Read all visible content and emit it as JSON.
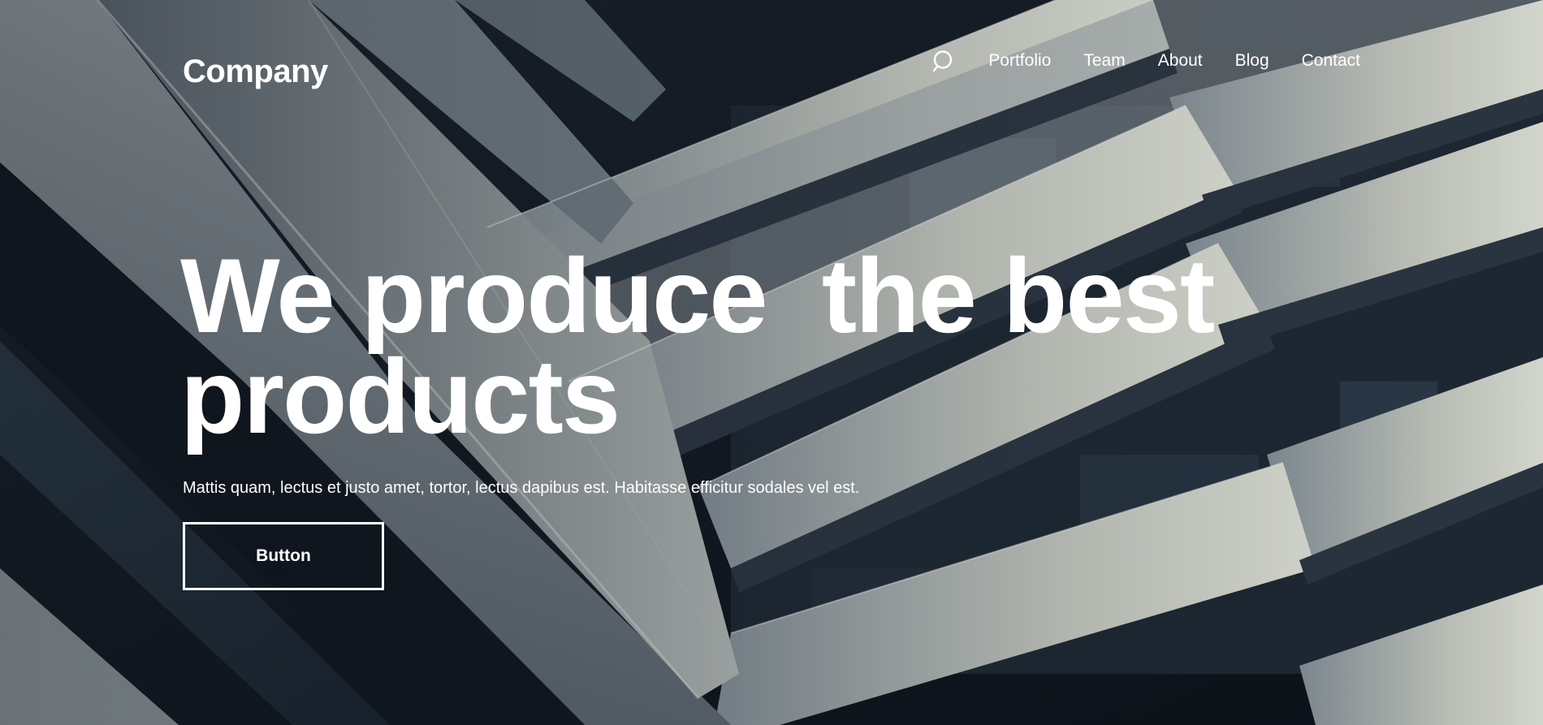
{
  "header": {
    "logo": "Company",
    "search_icon": "search-icon",
    "nav": [
      {
        "label": "Portfolio"
      },
      {
        "label": "Team"
      },
      {
        "label": "About"
      },
      {
        "label": "Blog"
      },
      {
        "label": "Contact"
      }
    ]
  },
  "hero": {
    "headline_line1": "We produce  the best",
    "headline_line2": "products",
    "subtitle": "Mattis quam, lectus et justo amet, tortor, lectus dapibus est. Habitasse efficitur sodales vel est.",
    "button_label": "Button"
  },
  "colors": {
    "text": "#ffffff",
    "background_dark": "#121821",
    "panel_light": "#c9ccc4"
  }
}
